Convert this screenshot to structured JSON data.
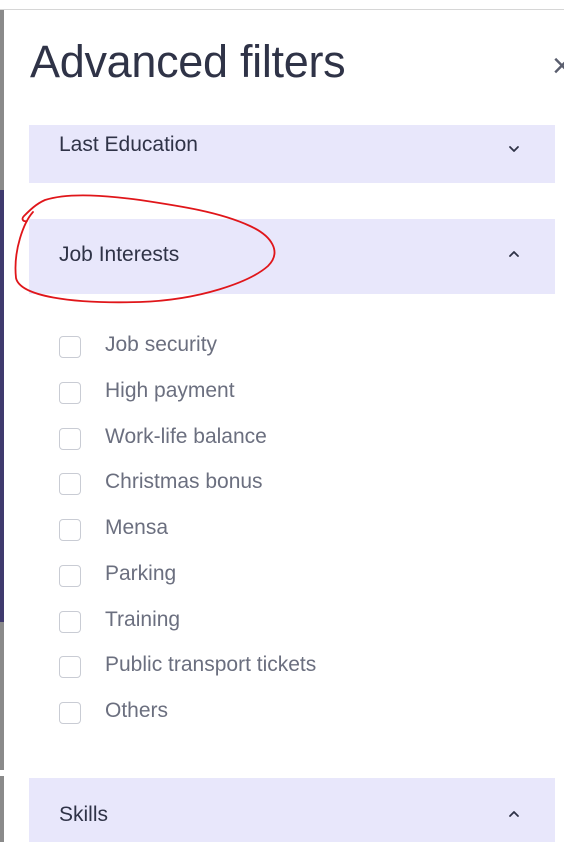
{
  "panel": {
    "title": "Advanced filters",
    "close_icon": "close-icon"
  },
  "sections": {
    "last_education": {
      "label": "Last Education",
      "expanded": false,
      "icon": "chevron-down-icon"
    },
    "job_interests": {
      "label": "Job Interests",
      "expanded": true,
      "icon": "chevron-up-icon"
    },
    "skills": {
      "label": "Skills",
      "expanded": true,
      "icon": "chevron-up-icon"
    }
  },
  "job_interests_options": [
    {
      "label": "Job security",
      "checked": false
    },
    {
      "label": "High payment",
      "checked": false
    },
    {
      "label": "Work-life balance",
      "checked": false
    },
    {
      "label": "Christmas bonus",
      "checked": false
    },
    {
      "label": "Mensa",
      "checked": false
    },
    {
      "label": "Parking",
      "checked": false
    },
    {
      "label": "Training",
      "checked": false
    },
    {
      "label": "Public transport tickets",
      "checked": false
    },
    {
      "label": "Others",
      "checked": false
    }
  ],
  "colors": {
    "section_background": "#e8e7fb",
    "title_text": "#2f3347",
    "option_text": "#6b6f7f",
    "annotation_stroke": "#e0161a"
  }
}
